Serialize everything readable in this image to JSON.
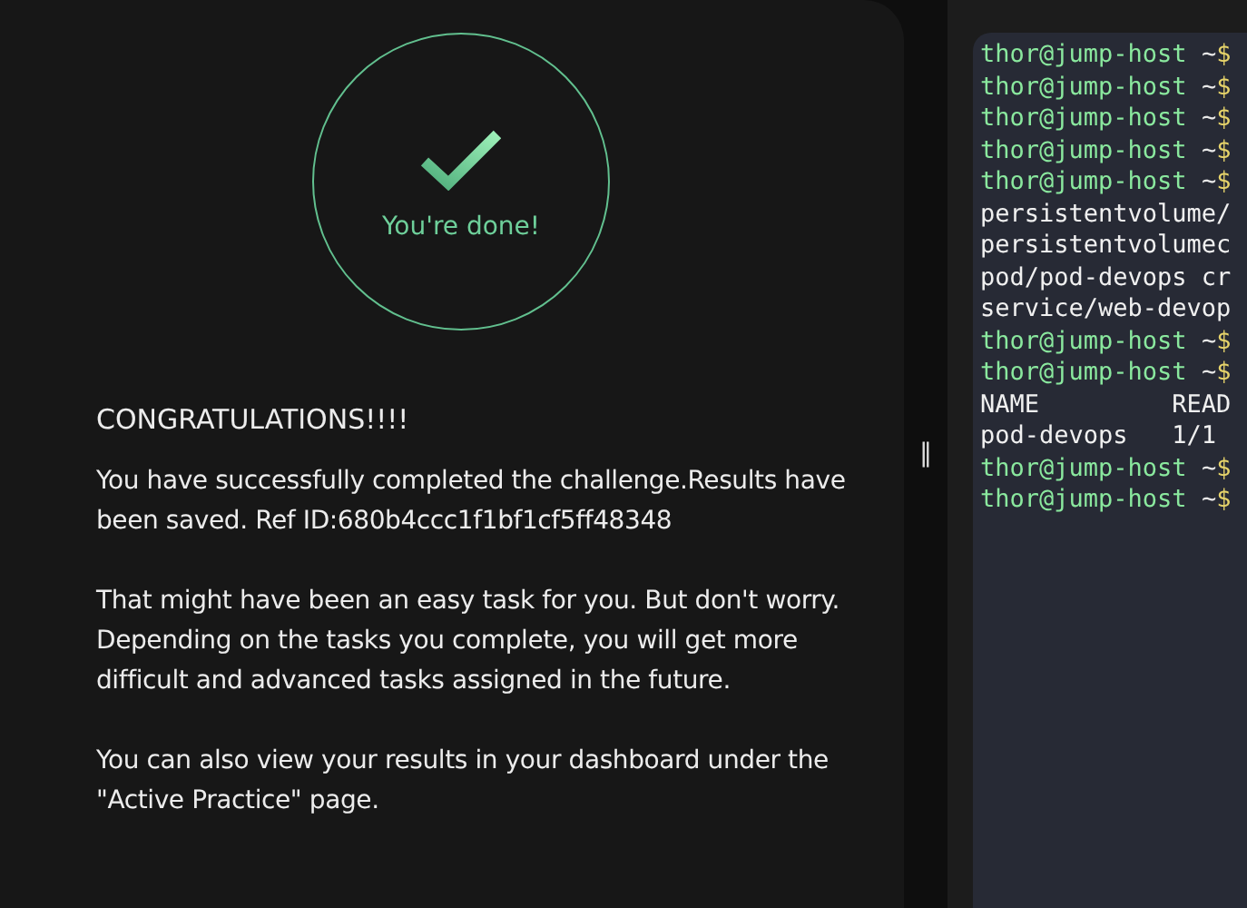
{
  "result_panel": {
    "status": "You're done!",
    "heading": "CONGRATULATIONS!!!!",
    "paragraphs": [
      "You have successfully completed the challenge.Results have been saved. Ref ID:680b4ccc1f1bf1cf5ff48348",
      "That might have been an easy task for you. But don't worry. Depending on the tasks you complete, you will get more difficult and advanced tasks assigned in the future.",
      "You can also view your results in your dashboard under the \"Active Practice\" page."
    ]
  },
  "splitter": {
    "handle": "‖"
  },
  "terminal": {
    "lines": [
      {
        "kind": "prompt",
        "user": "thor@jump-host",
        "path": "~",
        "symbol": "$"
      },
      {
        "kind": "prompt",
        "user": "thor@jump-host",
        "path": "~",
        "symbol": "$"
      },
      {
        "kind": "prompt",
        "user": "thor@jump-host",
        "path": "~",
        "symbol": "$"
      },
      {
        "kind": "prompt",
        "user": "thor@jump-host",
        "path": "~",
        "symbol": "$"
      },
      {
        "kind": "prompt",
        "user": "thor@jump-host",
        "path": "~",
        "symbol": "$"
      },
      {
        "kind": "output",
        "text": "persistentvolume/"
      },
      {
        "kind": "output",
        "text": "persistentvolumec"
      },
      {
        "kind": "output",
        "text": "pod/pod-devops cr"
      },
      {
        "kind": "output",
        "text": "service/web-devop"
      },
      {
        "kind": "prompt",
        "user": "thor@jump-host",
        "path": "~",
        "symbol": "$"
      },
      {
        "kind": "prompt",
        "user": "thor@jump-host",
        "path": "~",
        "symbol": "$"
      },
      {
        "kind": "output",
        "text": "NAME         READ"
      },
      {
        "kind": "output",
        "text": "pod-devops   1/1"
      },
      {
        "kind": "prompt",
        "user": "thor@jump-host",
        "path": "~",
        "symbol": "$"
      },
      {
        "kind": "prompt",
        "user": "thor@jump-host",
        "path": "~",
        "symbol": "$"
      }
    ]
  }
}
